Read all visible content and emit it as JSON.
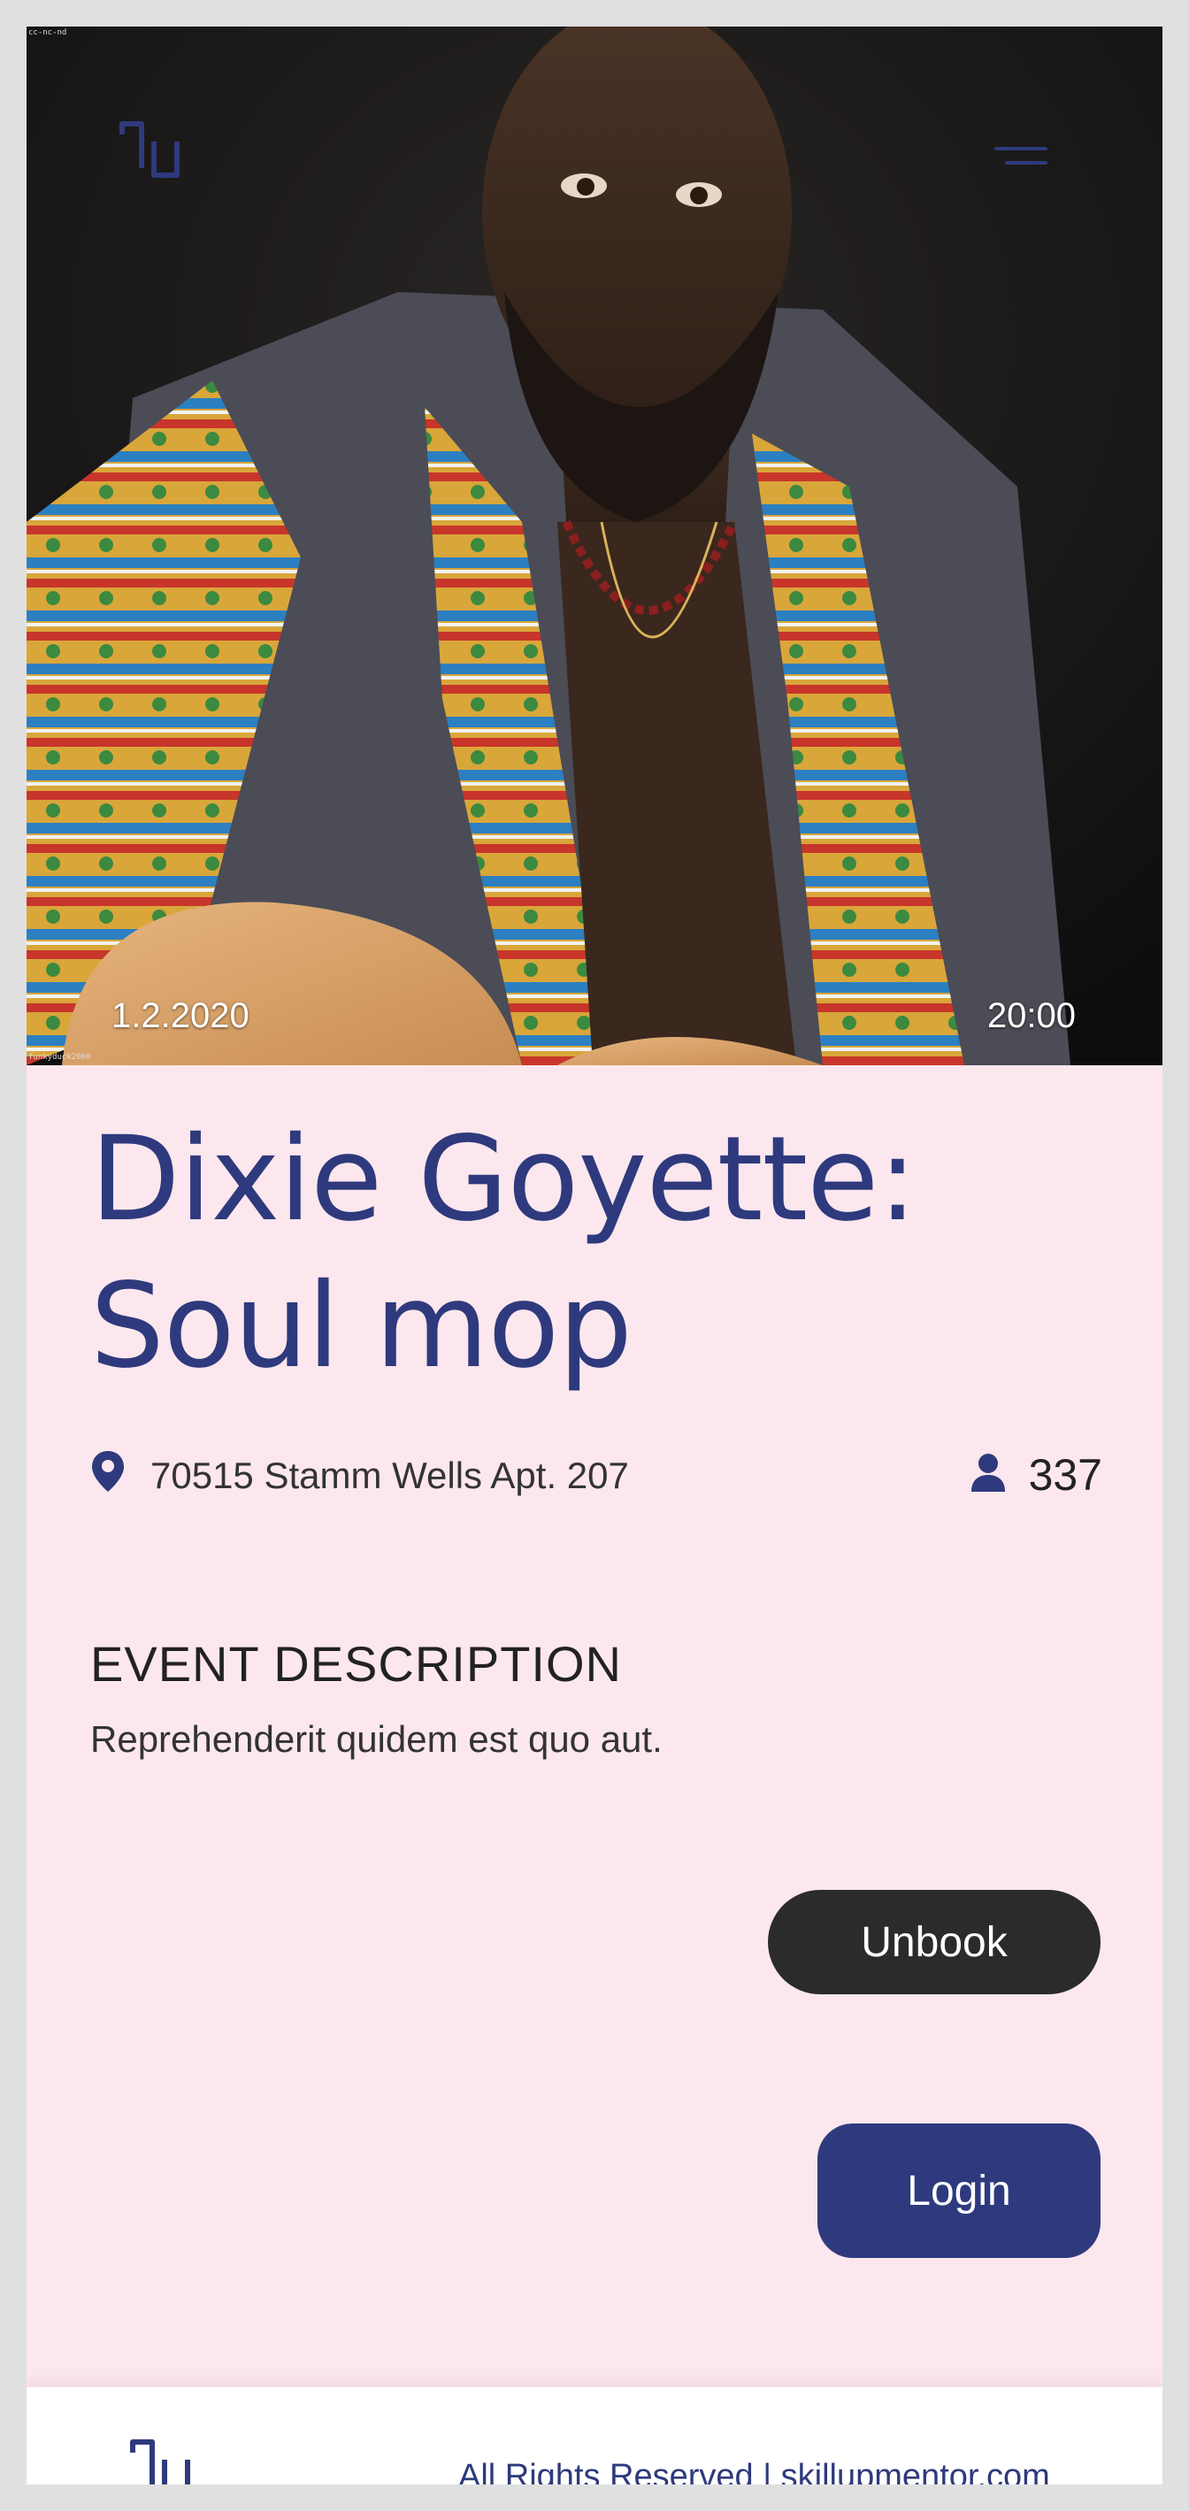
{
  "hero": {
    "license": "cc-nc-nd",
    "credit": "funkyduck2000",
    "date": "1.2.2020",
    "time": "20:00"
  },
  "event": {
    "title_line1": "Dixie Goyette:",
    "title_line2": "Soul mop",
    "address": "70515 Stamm Wells Apt. 207",
    "attendees": "337",
    "description_heading": "EVENT DESCRIPTION",
    "description": "Reprehenderit quidem est quo aut."
  },
  "actions": {
    "unbook_label": "Unbook",
    "login_label": "Login"
  },
  "footer": {
    "rights": "All Rights Reserved | skillupmentor.com"
  },
  "icons": {
    "logo": "nu-logo-icon",
    "menu": "hamburger-menu-icon",
    "location": "map-pin-icon",
    "attendees": "person-icon"
  },
  "colors": {
    "brand": "#2e3a7d",
    "background": "#fde7ee",
    "unbook_button": "#2b2b2b"
  }
}
